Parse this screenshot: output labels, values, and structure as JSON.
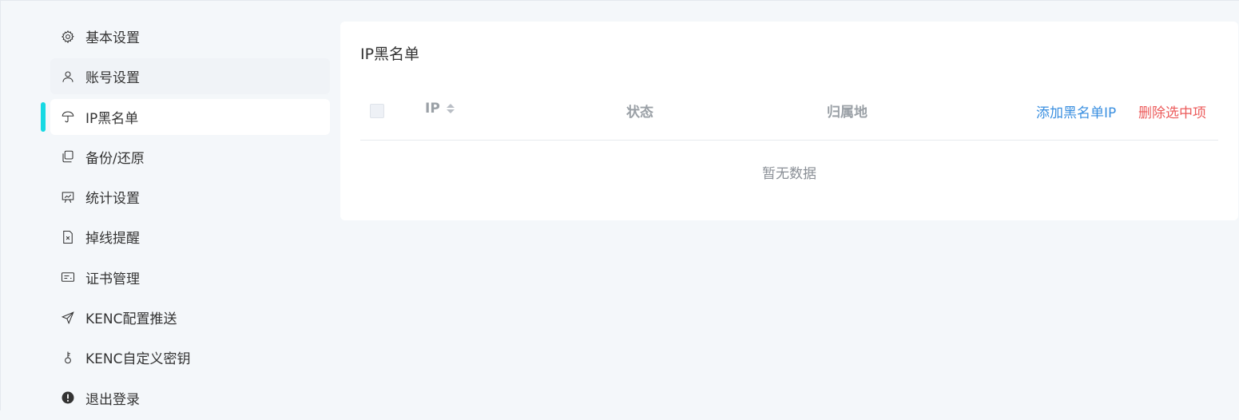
{
  "sidebar": {
    "items": [
      {
        "label": "基本设置",
        "icon": "gear-icon"
      },
      {
        "label": "账号设置",
        "icon": "user-icon"
      },
      {
        "label": "IP黑名单",
        "icon": "umbrella-icon"
      },
      {
        "label": "备份/还原",
        "icon": "copy-icon"
      },
      {
        "label": "统计设置",
        "icon": "presentation-icon"
      },
      {
        "label": "掉线提醒",
        "icon": "file-x-icon"
      },
      {
        "label": "证书管理",
        "icon": "certificate-icon"
      },
      {
        "label": "KENC配置推送",
        "icon": "send-icon"
      },
      {
        "label": "KENC自定义密钥",
        "icon": "key-icon"
      },
      {
        "label": "退出登录",
        "icon": "exclamation-circle-icon"
      }
    ],
    "active_index": 2,
    "accent_color": "#16d9e3"
  },
  "main": {
    "title": "IP黑名单",
    "table": {
      "columns": [
        "IP",
        "状态",
        "归属地"
      ],
      "actions": {
        "add": "添加黑名单IP",
        "delete": "删除选中项"
      },
      "empty_text": "暂无数据"
    }
  }
}
